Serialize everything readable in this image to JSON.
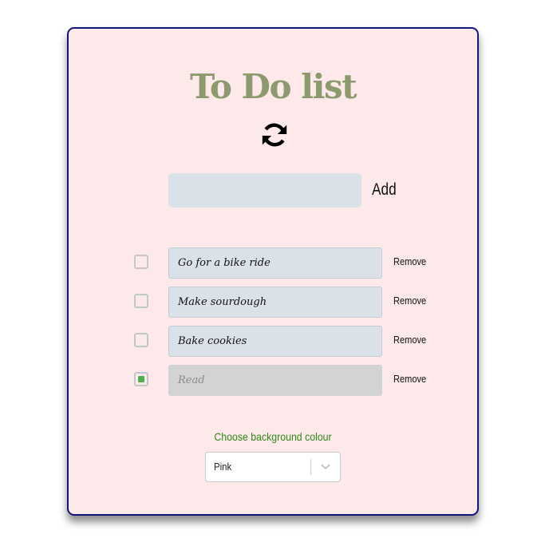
{
  "header": {
    "title": "To Do list"
  },
  "icons": {
    "refresh": "refresh-icon",
    "dropdown": "chevron-down-icon"
  },
  "new_task": {
    "value": "",
    "placeholder": "",
    "add_label": "Add"
  },
  "tasks": [
    {
      "label": "Go for a bike ride",
      "done": false,
      "remove_label": "Remove"
    },
    {
      "label": "Make sourdough",
      "done": false,
      "remove_label": "Remove"
    },
    {
      "label": "Bake cookies",
      "done": false,
      "remove_label": "Remove"
    },
    {
      "label": "Read",
      "done": true,
      "remove_label": "Remove"
    }
  ],
  "background": {
    "label": "Choose background colour",
    "selected": "Pink"
  },
  "colors": {
    "card_background": "#fde8ea",
    "card_border": "#14147a",
    "title": "#8c9a6e",
    "task_field": "#dbe1e8",
    "task_done_field": "#d3d3d3",
    "checkbox_checked": "#4caf50",
    "label_green": "#2f8a1c"
  }
}
